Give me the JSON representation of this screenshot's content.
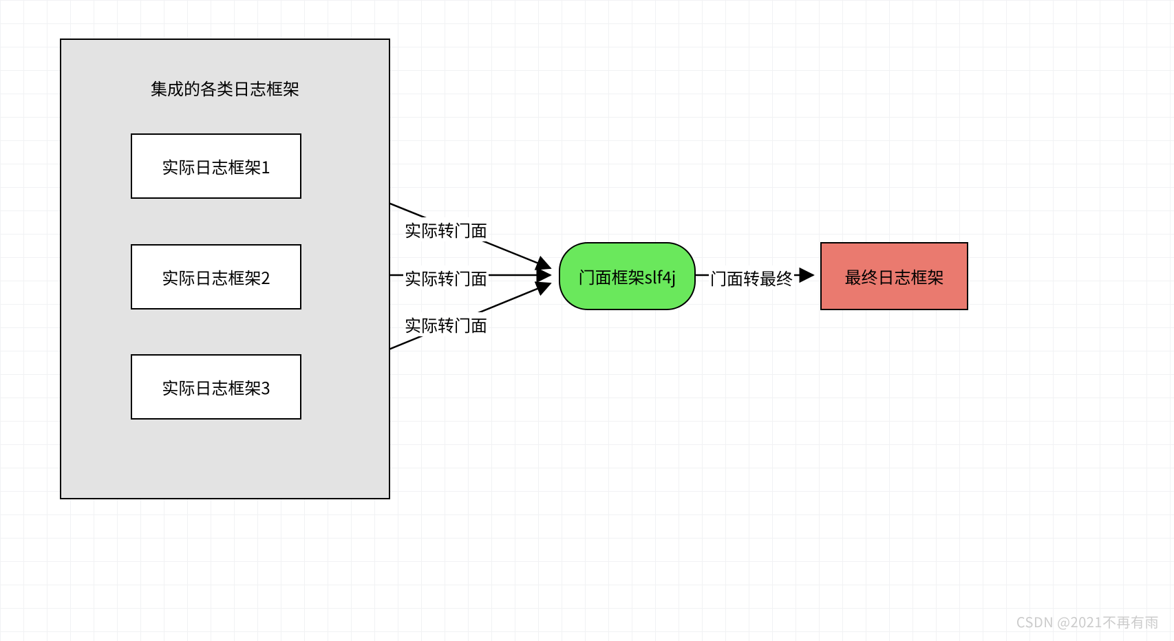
{
  "frame": {
    "title": "集成的各类日志框架"
  },
  "actual": {
    "one": "实际日志框架1",
    "two": "实际日志框架2",
    "three": "实际日志框架3"
  },
  "edgeLabels": {
    "bridge1": "实际转门面",
    "bridge2": "实际转门面",
    "bridge3": "实际转门面",
    "toFinal": "门面转最终"
  },
  "facade": "门面框架slf4j",
  "final": "最终日志框架",
  "watermark": "CSDN @2021不再有雨",
  "colors": {
    "facadeFill": "#6ae85c",
    "finalFill": "#ea7a6f",
    "frameFill": "#e3e3e3"
  }
}
